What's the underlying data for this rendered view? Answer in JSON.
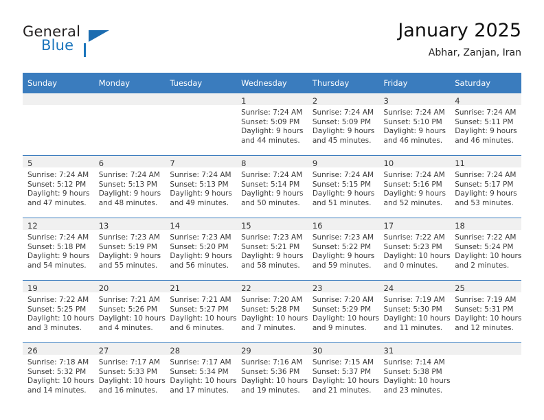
{
  "brand": {
    "word1": "General",
    "word2": "Blue",
    "logo_icon": "triangle-logo-icon",
    "accent_color": "#1b75bc"
  },
  "header": {
    "title": "January 2025",
    "subtitle": "Abhar, Zanjan, Iran"
  },
  "theme": {
    "header_bg": "#3a7cbe",
    "daynum_bg": "#f0f0f0",
    "grid_line": "#3a7cbe",
    "text": "#3a3a3a"
  },
  "calendar": {
    "weekday_headers": [
      "Sunday",
      "Monday",
      "Tuesday",
      "Wednesday",
      "Thursday",
      "Friday",
      "Saturday"
    ],
    "weeks": [
      [
        {
          "day": "",
          "lines": []
        },
        {
          "day": "",
          "lines": []
        },
        {
          "day": "",
          "lines": []
        },
        {
          "day": "1",
          "lines": [
            "Sunrise: 7:24 AM",
            "Sunset: 5:09 PM",
            "Daylight: 9 hours",
            "and 44 minutes."
          ]
        },
        {
          "day": "2",
          "lines": [
            "Sunrise: 7:24 AM",
            "Sunset: 5:09 PM",
            "Daylight: 9 hours",
            "and 45 minutes."
          ]
        },
        {
          "day": "3",
          "lines": [
            "Sunrise: 7:24 AM",
            "Sunset: 5:10 PM",
            "Daylight: 9 hours",
            "and 46 minutes."
          ]
        },
        {
          "day": "4",
          "lines": [
            "Sunrise: 7:24 AM",
            "Sunset: 5:11 PM",
            "Daylight: 9 hours",
            "and 46 minutes."
          ]
        }
      ],
      [
        {
          "day": "5",
          "lines": [
            "Sunrise: 7:24 AM",
            "Sunset: 5:12 PM",
            "Daylight: 9 hours",
            "and 47 minutes."
          ]
        },
        {
          "day": "6",
          "lines": [
            "Sunrise: 7:24 AM",
            "Sunset: 5:13 PM",
            "Daylight: 9 hours",
            "and 48 minutes."
          ]
        },
        {
          "day": "7",
          "lines": [
            "Sunrise: 7:24 AM",
            "Sunset: 5:13 PM",
            "Daylight: 9 hours",
            "and 49 minutes."
          ]
        },
        {
          "day": "8",
          "lines": [
            "Sunrise: 7:24 AM",
            "Sunset: 5:14 PM",
            "Daylight: 9 hours",
            "and 50 minutes."
          ]
        },
        {
          "day": "9",
          "lines": [
            "Sunrise: 7:24 AM",
            "Sunset: 5:15 PM",
            "Daylight: 9 hours",
            "and 51 minutes."
          ]
        },
        {
          "day": "10",
          "lines": [
            "Sunrise: 7:24 AM",
            "Sunset: 5:16 PM",
            "Daylight: 9 hours",
            "and 52 minutes."
          ]
        },
        {
          "day": "11",
          "lines": [
            "Sunrise: 7:24 AM",
            "Sunset: 5:17 PM",
            "Daylight: 9 hours",
            "and 53 minutes."
          ]
        }
      ],
      [
        {
          "day": "12",
          "lines": [
            "Sunrise: 7:24 AM",
            "Sunset: 5:18 PM",
            "Daylight: 9 hours",
            "and 54 minutes."
          ]
        },
        {
          "day": "13",
          "lines": [
            "Sunrise: 7:23 AM",
            "Sunset: 5:19 PM",
            "Daylight: 9 hours",
            "and 55 minutes."
          ]
        },
        {
          "day": "14",
          "lines": [
            "Sunrise: 7:23 AM",
            "Sunset: 5:20 PM",
            "Daylight: 9 hours",
            "and 56 minutes."
          ]
        },
        {
          "day": "15",
          "lines": [
            "Sunrise: 7:23 AM",
            "Sunset: 5:21 PM",
            "Daylight: 9 hours",
            "and 58 minutes."
          ]
        },
        {
          "day": "16",
          "lines": [
            "Sunrise: 7:23 AM",
            "Sunset: 5:22 PM",
            "Daylight: 9 hours",
            "and 59 minutes."
          ]
        },
        {
          "day": "17",
          "lines": [
            "Sunrise: 7:22 AM",
            "Sunset: 5:23 PM",
            "Daylight: 10 hours",
            "and 0 minutes."
          ]
        },
        {
          "day": "18",
          "lines": [
            "Sunrise: 7:22 AM",
            "Sunset: 5:24 PM",
            "Daylight: 10 hours",
            "and 2 minutes."
          ]
        }
      ],
      [
        {
          "day": "19",
          "lines": [
            "Sunrise: 7:22 AM",
            "Sunset: 5:25 PM",
            "Daylight: 10 hours",
            "and 3 minutes."
          ]
        },
        {
          "day": "20",
          "lines": [
            "Sunrise: 7:21 AM",
            "Sunset: 5:26 PM",
            "Daylight: 10 hours",
            "and 4 minutes."
          ]
        },
        {
          "day": "21",
          "lines": [
            "Sunrise: 7:21 AM",
            "Sunset: 5:27 PM",
            "Daylight: 10 hours",
            "and 6 minutes."
          ]
        },
        {
          "day": "22",
          "lines": [
            "Sunrise: 7:20 AM",
            "Sunset: 5:28 PM",
            "Daylight: 10 hours",
            "and 7 minutes."
          ]
        },
        {
          "day": "23",
          "lines": [
            "Sunrise: 7:20 AM",
            "Sunset: 5:29 PM",
            "Daylight: 10 hours",
            "and 9 minutes."
          ]
        },
        {
          "day": "24",
          "lines": [
            "Sunrise: 7:19 AM",
            "Sunset: 5:30 PM",
            "Daylight: 10 hours",
            "and 11 minutes."
          ]
        },
        {
          "day": "25",
          "lines": [
            "Sunrise: 7:19 AM",
            "Sunset: 5:31 PM",
            "Daylight: 10 hours",
            "and 12 minutes."
          ]
        }
      ],
      [
        {
          "day": "26",
          "lines": [
            "Sunrise: 7:18 AM",
            "Sunset: 5:32 PM",
            "Daylight: 10 hours",
            "and 14 minutes."
          ]
        },
        {
          "day": "27",
          "lines": [
            "Sunrise: 7:17 AM",
            "Sunset: 5:33 PM",
            "Daylight: 10 hours",
            "and 16 minutes."
          ]
        },
        {
          "day": "28",
          "lines": [
            "Sunrise: 7:17 AM",
            "Sunset: 5:34 PM",
            "Daylight: 10 hours",
            "and 17 minutes."
          ]
        },
        {
          "day": "29",
          "lines": [
            "Sunrise: 7:16 AM",
            "Sunset: 5:36 PM",
            "Daylight: 10 hours",
            "and 19 minutes."
          ]
        },
        {
          "day": "30",
          "lines": [
            "Sunrise: 7:15 AM",
            "Sunset: 5:37 PM",
            "Daylight: 10 hours",
            "and 21 minutes."
          ]
        },
        {
          "day": "31",
          "lines": [
            "Sunrise: 7:14 AM",
            "Sunset: 5:38 PM",
            "Daylight: 10 hours",
            "and 23 minutes."
          ]
        },
        {
          "day": "",
          "lines": []
        }
      ]
    ]
  }
}
